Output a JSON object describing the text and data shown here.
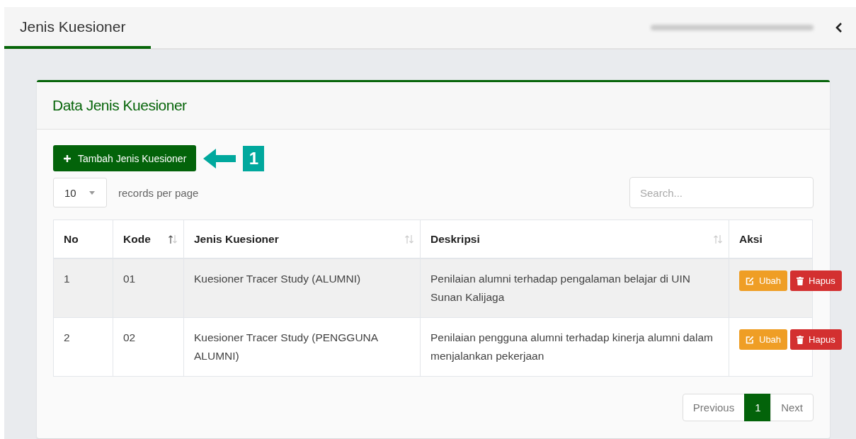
{
  "header": {
    "title": "Jenis Kuesioner",
    "tab_active": true
  },
  "panel": {
    "title": "Data Jenis Kuesioner",
    "add_button": {
      "label": "Tambah Jenis Kuesioner"
    },
    "callout": {
      "number": "1"
    },
    "page_size": {
      "value": "10",
      "label": "records per page"
    },
    "search": {
      "placeholder": "Search..."
    },
    "table": {
      "columns": [
        {
          "label": "No"
        },
        {
          "label": "Kode",
          "sorted_ascending": true
        },
        {
          "label": "Jenis Kuesioner",
          "sorted_ascending": false
        },
        {
          "label": "Deskripsi",
          "sorted_ascending": false
        },
        {
          "label": "Aksi"
        }
      ],
      "rows": [
        {
          "no": "1",
          "kode": "01",
          "jenis": "Kuesioner Tracer Study (ALUMNI)",
          "deskripsi": "Penilaian alumni terhadap pengalaman belajar di UIN Sunan Kalijaga",
          "actions": [
            {
              "kind": "edit",
              "label": "Ubah"
            },
            {
              "kind": "delete",
              "label": "Hapus"
            }
          ]
        },
        {
          "no": "2",
          "kode": "02",
          "jenis": "Kuesioner Tracer Study (PENGGUNA ALUMNI)",
          "deskripsi": "Penilaian pengguna alumni terhadap kinerja alumni dalam menjalankan pekerjaan",
          "actions": [
            {
              "kind": "edit",
              "label": "Ubah"
            },
            {
              "kind": "delete",
              "label": "Hapus"
            }
          ]
        }
      ]
    },
    "pagination": {
      "previous": "Previous",
      "pages": [
        {
          "label": "1",
          "selected": true
        }
      ],
      "next": "Next"
    }
  }
}
